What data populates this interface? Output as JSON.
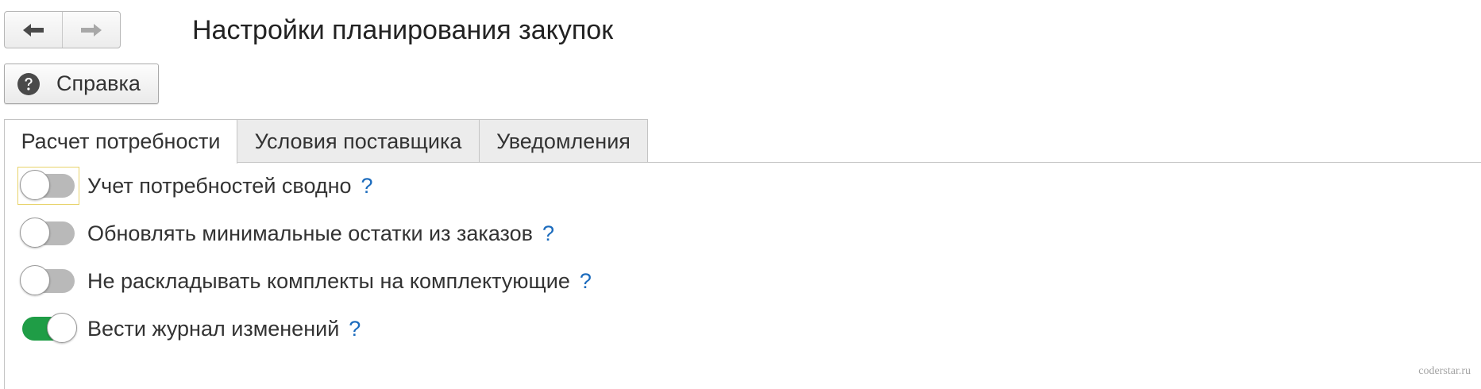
{
  "header": {
    "title": "Настройки планирования закупок",
    "back_icon": "arrow-left-icon",
    "forward_icon": "arrow-right-icon"
  },
  "help_button": {
    "label": "Справка",
    "icon": "question-circle-icon"
  },
  "tabs": [
    {
      "label": "Расчет потребности",
      "active": true
    },
    {
      "label": "Условия поставщика",
      "active": false
    },
    {
      "label": "Уведомления",
      "active": false
    }
  ],
  "settings": [
    {
      "label": "Учет потребностей сводно",
      "enabled": false,
      "help": "?"
    },
    {
      "label": "Обновлять минимальные остатки из заказов",
      "enabled": false,
      "help": "?"
    },
    {
      "label": "Не раскладывать комплекты на комплектующие",
      "enabled": false,
      "help": "?"
    },
    {
      "label": "Вести журнал изменений",
      "enabled": true,
      "help": "?"
    }
  ],
  "colors": {
    "toggle_on": "#1f9d46",
    "toggle_off": "#b9b9b9",
    "help_link": "#1b6bbd",
    "focus_outline": "#e8d36b"
  },
  "watermark": "coderstar.ru"
}
